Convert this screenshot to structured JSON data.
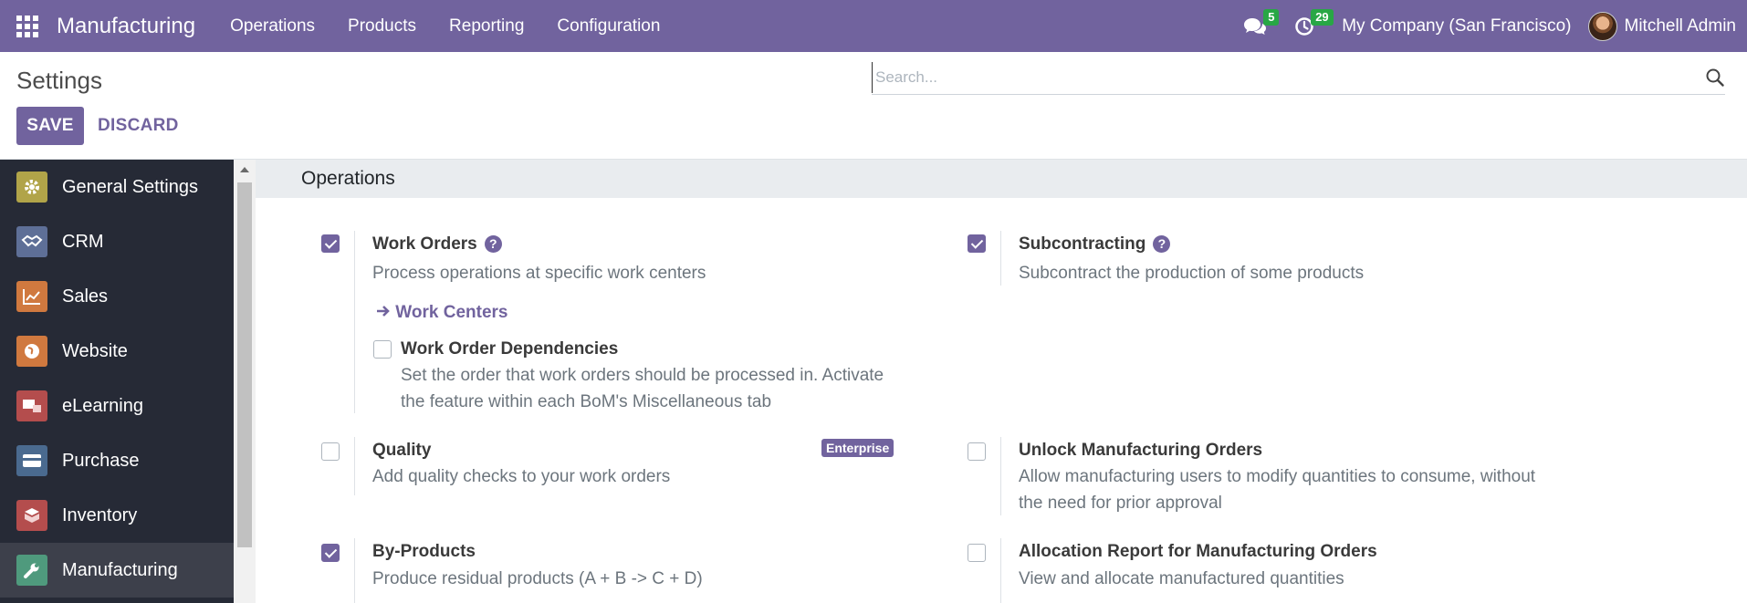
{
  "navbar": {
    "brand": "Manufacturing",
    "menu": [
      "Operations",
      "Products",
      "Reporting",
      "Configuration"
    ],
    "messages_count": "5",
    "activities_count": "29",
    "company": "My Company (San Francisco)",
    "user": "Mitchell Admin"
  },
  "control": {
    "title": "Settings",
    "save_label": "SAVE",
    "discard_label": "DISCARD",
    "search_placeholder": "Search..."
  },
  "sidebar": {
    "items": [
      {
        "label": "General Settings",
        "icon": "gear-icon",
        "color": "#b1a449"
      },
      {
        "label": "CRM",
        "icon": "handshake-icon",
        "color": "#5e6f97"
      },
      {
        "label": "Sales",
        "icon": "chart-icon",
        "color": "#d0793f"
      },
      {
        "label": "Website",
        "icon": "globe-icon",
        "color": "#d0793f"
      },
      {
        "label": "eLearning",
        "icon": "learning-icon",
        "color": "#b44d4d"
      },
      {
        "label": "Purchase",
        "icon": "card-icon",
        "color": "#4a6a8f"
      },
      {
        "label": "Inventory",
        "icon": "box-icon",
        "color": "#b44d4d"
      },
      {
        "label": "Manufacturing",
        "icon": "wrench-icon",
        "color": "#4f9a7d"
      }
    ],
    "active": "Manufacturing"
  },
  "section": {
    "title": "Operations"
  },
  "settings": {
    "work_orders": {
      "title": "Work Orders",
      "desc": "Process operations at specific work centers",
      "checked": true
    },
    "work_centers_link": "Work Centers",
    "wo_dependencies": {
      "title": "Work Order Dependencies",
      "desc1": "Set the order that work orders should be processed in. Activate",
      "desc2": "the feature within each BoM's Miscellaneous tab",
      "checked": false
    },
    "subcontracting": {
      "title": "Subcontracting",
      "desc": "Subcontract the production of some products",
      "checked": true
    },
    "quality": {
      "title": "Quality",
      "desc": "Add quality checks to your work orders",
      "badge": "Enterprise",
      "checked": false
    },
    "unlock_mo": {
      "title": "Unlock Manufacturing Orders",
      "desc1": "Allow manufacturing users to modify quantities to consume, without",
      "desc2": "the need for prior approval",
      "checked": false
    },
    "by_products": {
      "title": "By-Products",
      "desc": "Produce residual products (A + B -> C + D)",
      "checked": true
    },
    "allocation_report": {
      "title": "Allocation Report for Manufacturing Orders",
      "desc": "View and allocate manufactured quantities",
      "checked": false
    }
  },
  "colors": {
    "primary": "#71639e",
    "badge_green": "#28a745",
    "sidebar_bg": "#262a36"
  }
}
